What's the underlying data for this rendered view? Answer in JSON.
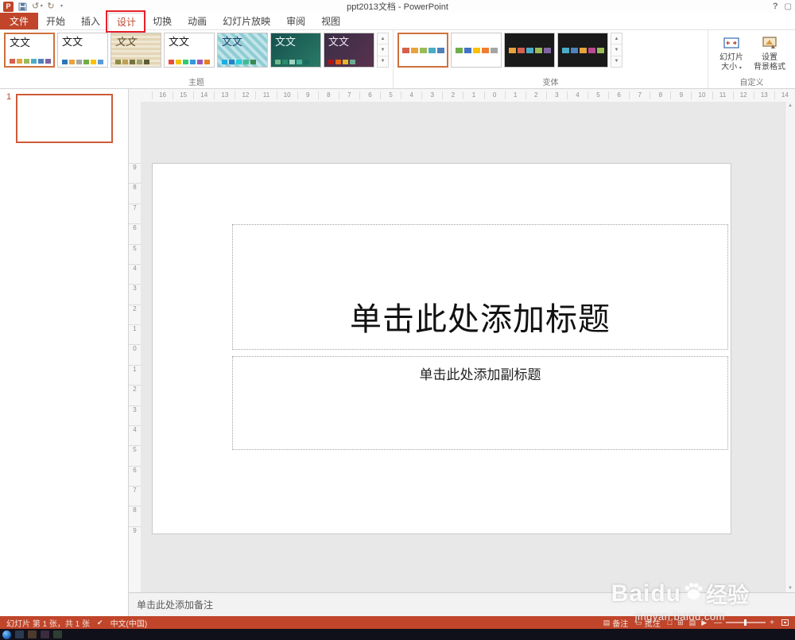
{
  "colors": {
    "accent": "#C0452A",
    "annotation_box": "#E8212B",
    "gallery_selection": "#D0703C",
    "taskbar_bg": "#10101A"
  },
  "titlebar": {
    "title": "ppt2013文档 - PowerPoint",
    "help": "?"
  },
  "tabs": [
    {
      "id": "file",
      "label": "文件",
      "file": true
    },
    {
      "id": "home",
      "label": "开始"
    },
    {
      "id": "insert",
      "label": "插入"
    },
    {
      "id": "design",
      "label": "设计",
      "selected": true
    },
    {
      "id": "transitions",
      "label": "切换"
    },
    {
      "id": "animations",
      "label": "动画"
    },
    {
      "id": "slideshow",
      "label": "幻灯片放映"
    },
    {
      "id": "review",
      "label": "审阅"
    },
    {
      "id": "view",
      "label": "视图"
    }
  ],
  "ribbon": {
    "themes_label": "主题",
    "variants_label": "变体",
    "customize_label": "自定义",
    "slide_size": [
      "幻灯片",
      "大小"
    ],
    "format_background": [
      "设置",
      "背景格式"
    ],
    "themes": [
      {
        "label": "文文",
        "bg": "#ffffff",
        "fg": "#1a1a1a",
        "selected": true,
        "stripes": [
          "#D6604D",
          "#E8A33D",
          "#9BBB59",
          "#4BACC6",
          "#4F81BD",
          "#8064A2"
        ]
      },
      {
        "label": "文文",
        "bg": "#ffffff",
        "fg": "#1a1a1a",
        "stripes": [
          "#2E75B6",
          "#E8A33D",
          "#A5A5A5",
          "#70AD47",
          "#FFC000",
          "#5B9BD5"
        ]
      },
      {
        "label": "文文",
        "pattern": "beige",
        "fg": "#5B4B28",
        "script": true,
        "stripes": [
          "#8C8C46",
          "#BFA054",
          "#77733C",
          "#A0A16E",
          "#5E5B36"
        ]
      },
      {
        "label": "文文",
        "bg": "#ffffff",
        "fg": "#1a1a1a",
        "stripes": [
          "#E84C3D",
          "#F1C40F",
          "#2ECC71",
          "#3498DB",
          "#9B59B6",
          "#E67E22"
        ]
      },
      {
        "label": "文文",
        "pattern": "checker",
        "fg": "#17406D",
        "stripes": [
          "#1CADE4",
          "#2683C6",
          "#27CED7",
          "#42BA97",
          "#3E8853"
        ]
      },
      {
        "label": "文文",
        "bg": "linear-gradient(135deg,#14504E,#2B7A66)",
        "fg": "#EAF6F4",
        "stripes": [
          "#6FB98F",
          "#2C8A6E",
          "#9ED6C0",
          "#45B39C",
          "#1B6B5F"
        ]
      },
      {
        "label": "文文",
        "bg": "linear-gradient(135deg,#3A2E46,#58324E)",
        "fg": "#F0E6F2",
        "stripes": [
          "#B01513",
          "#EA6312",
          "#E6B729",
          "#6AAC90"
        ]
      }
    ],
    "variants": [
      {
        "bg": "#ffffff",
        "selected": true,
        "stripes": [
          "#D6604D",
          "#E8A33D",
          "#9BBB59",
          "#4BACC6",
          "#4F81BD"
        ]
      },
      {
        "bg": "#ffffff",
        "stripes": [
          "#70AD47",
          "#4472C4",
          "#FFC000",
          "#ED7D31",
          "#A5A5A5"
        ]
      },
      {
        "bg": "#1A1A1A",
        "stripes": [
          "#E8A33D",
          "#D6604D",
          "#4BACC6",
          "#9BBB59",
          "#8064A2"
        ]
      },
      {
        "bg": "#1A1A1A",
        "stripes": [
          "#4BACC6",
          "#4F81BD",
          "#E8A33D",
          "#B84A93",
          "#9BBB59"
        ]
      }
    ]
  },
  "ruler": {
    "horizontal": [
      "16",
      "15",
      "14",
      "13",
      "12",
      "11",
      "10",
      "9",
      "8",
      "7",
      "6",
      "5",
      "4",
      "3",
      "2",
      "1",
      "0",
      "1",
      "2",
      "3",
      "4",
      "5",
      "6",
      "7",
      "8",
      "9",
      "10",
      "11",
      "12",
      "13",
      "14"
    ],
    "vertical": [
      "9",
      "8",
      "7",
      "6",
      "5",
      "4",
      "3",
      "2",
      "1",
      "0",
      "1",
      "2",
      "3",
      "4",
      "5",
      "6",
      "7",
      "8",
      "9"
    ]
  },
  "thumbnails": {
    "slide_number": "1"
  },
  "slide": {
    "title_placeholder": "单击此处添加标题",
    "subtitle_placeholder": "单击此处添加副标题"
  },
  "notes": {
    "placeholder": "单击此处添加备注"
  },
  "statusbar": {
    "slide_info": "幻灯片 第 1 张，共 1 张",
    "language": "中文(中国)",
    "notes": "备注",
    "comments": "批注"
  },
  "taskbar": {
    "icon_colors": [
      "#2B3A4E",
      "#4E3A2B",
      "#3A2B3E",
      "#2E3E32"
    ]
  },
  "watermark": {
    "brand": "Baidu",
    "suffix": "经验",
    "url": "jingyan.baidu.com"
  }
}
